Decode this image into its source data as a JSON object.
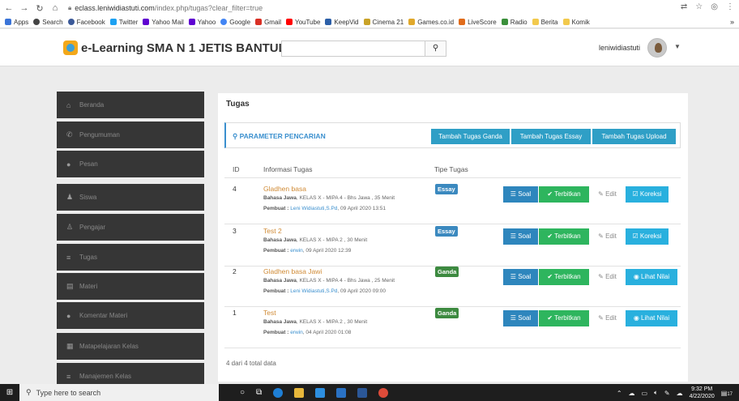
{
  "browser": {
    "url_host": "eclass.leniwidiastuti.com",
    "url_path": "/index.php/tugas?clear_filter=true",
    "bookmarks": [
      {
        "label": "Apps",
        "color": "#3a74d8"
      },
      {
        "label": "Search",
        "color": "#444444"
      },
      {
        "label": "Facebook",
        "color": "#3b5998"
      },
      {
        "label": "Twitter",
        "color": "#1da1f2"
      },
      {
        "label": "Yahoo Mail",
        "color": "#5f01d1"
      },
      {
        "label": "Yahoo",
        "color": "#5f01d1"
      },
      {
        "label": "Google",
        "color": "#4285f4"
      },
      {
        "label": "Gmail",
        "color": "#d93025"
      },
      {
        "label": "YouTube",
        "color": "#ff0000"
      },
      {
        "label": "KeepVid",
        "color": "#2c5fa8"
      },
      {
        "label": "Cinema 21",
        "color": "#c9a227"
      },
      {
        "label": "Games.co.id",
        "color": "#e0a82b"
      },
      {
        "label": "LiveScore",
        "color": "#e06b1a"
      },
      {
        "label": "Radio",
        "color": "#3a8f3a"
      },
      {
        "label": "Berita",
        "color": "#f2c94c"
      },
      {
        "label": "Komik",
        "color": "#f2c94c"
      }
    ]
  },
  "header": {
    "brand": "e-Learning SMA N 1 JETIS BANTUL",
    "search_placeholder": "",
    "search_icon": "search-icon",
    "username": "leniwidiastuti"
  },
  "sidebar": {
    "items": [
      {
        "label": "Beranda",
        "icon": "home-icon",
        "glyph": "⌂"
      },
      {
        "label": "Pengumuman",
        "icon": "megaphone-icon",
        "glyph": "✆"
      },
      {
        "label": "Pesan",
        "icon": "chat-icon",
        "glyph": "●"
      },
      {
        "label": "Siswa",
        "icon": "users-icon",
        "glyph": "♟"
      },
      {
        "label": "Pengajar",
        "icon": "user-icon",
        "glyph": "♙"
      },
      {
        "label": "Tugas",
        "icon": "list-icon",
        "glyph": "≡"
      },
      {
        "label": "Materi",
        "icon": "book-icon",
        "glyph": "▤"
      },
      {
        "label": "Komentar Materi",
        "icon": "comments-icon",
        "glyph": "●"
      },
      {
        "label": "Matapelajaran Kelas",
        "icon": "clipboard-icon",
        "glyph": "▦"
      },
      {
        "label": "Manajemen Kelas",
        "icon": "table-icon",
        "glyph": "≡"
      }
    ]
  },
  "main": {
    "title": "Tugas",
    "filter_label": "PARAMETER PENCARIAN",
    "buttons": {
      "ganda": "Tambah Tugas Ganda",
      "essay": "Tambah Tugas Essay",
      "upload": "Tambah Tugas Upload"
    },
    "columns": {
      "id": "ID",
      "info": "Informasi Tugas",
      "type": "Tipe Tugas"
    },
    "actions": {
      "soal": "Soal",
      "terbitkan": "Terbitkan",
      "edit": "Edit",
      "koreksi": "Koreksi",
      "lihat_nilai": "Lihat Nilai"
    },
    "rows": [
      {
        "id": "4",
        "title": "Gladhen basa",
        "subject": "Bahasa Jawa",
        "detail": ", KELAS X - MIPA 4 - Bhs Jawa , 35 Menit",
        "maker_label": "Pembuat :",
        "maker": "Leni Widiastuti,S.Pd",
        "date": ", 09 April 2020 13:51",
        "type": "Essay"
      },
      {
        "id": "3",
        "title": "Test 2",
        "subject": "Bahasa Jawa",
        "detail": ", KELAS X - MIPA 2 , 30 Menit",
        "maker_label": "Pembuat :",
        "maker": "erwin",
        "date": ", 09 April 2020 12:39",
        "type": "Essay"
      },
      {
        "id": "2",
        "title": "Gladhen basa Jawi",
        "subject": "Bahasa Jawa",
        "detail": ", KELAS X - MIPA 4 - Bhs Jawa , 25 Menit",
        "maker_label": "Pembuat :",
        "maker": "Leni Widiastuti,S.Pd",
        "date": ", 09 April 2020 09:00",
        "type": "Ganda"
      },
      {
        "id": "1",
        "title": "Test",
        "subject": "Bahasa Jawa",
        "detail": ", KELAS X - MIPA 2 , 30 Menit",
        "maker_label": "Pembuat :",
        "maker": "erwin",
        "date": ", 04 April 2020 01:08",
        "type": "Ganda"
      }
    ],
    "total": "4 dari 4 total data"
  },
  "taskbar": {
    "search_placeholder": "Type here to search",
    "time": "9:32 PM",
    "date": "4/22/2020",
    "notification_count": "17"
  }
}
